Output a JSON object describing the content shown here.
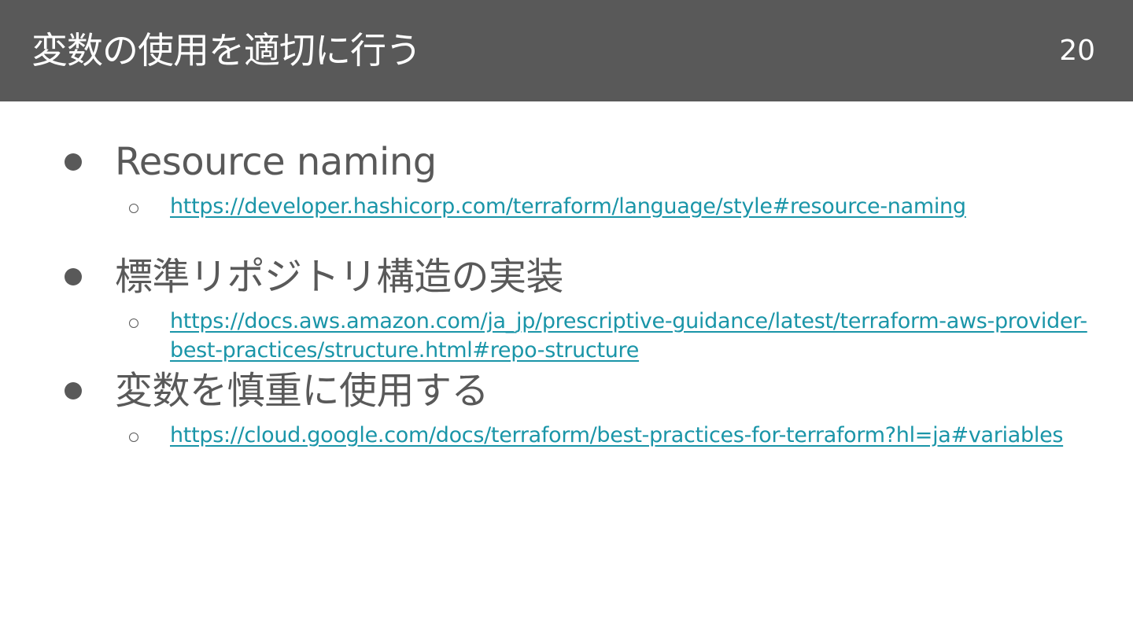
{
  "slide": {
    "title": "変数の使用を適切に行う",
    "page_number": "20"
  },
  "bullets": [
    {
      "text": "Resource naming",
      "link": "https://developer.hashicorp.com/terraform/language/style#resource-naming"
    },
    {
      "text": "標準リポジトリ構造の実装",
      "link": "https://docs.aws.amazon.com/ja_jp/prescriptive-guidance/latest/terraform-aws-provider-best-practices/structure.html#repo-structure"
    },
    {
      "text": "変数を慎重に使用する",
      "link": "https://cloud.google.com/docs/terraform/best-practices-for-terraform?hl=ja#variables"
    }
  ],
  "colors": {
    "header_bg": "#595959",
    "text": "#595959",
    "link": "#1a95a8"
  }
}
